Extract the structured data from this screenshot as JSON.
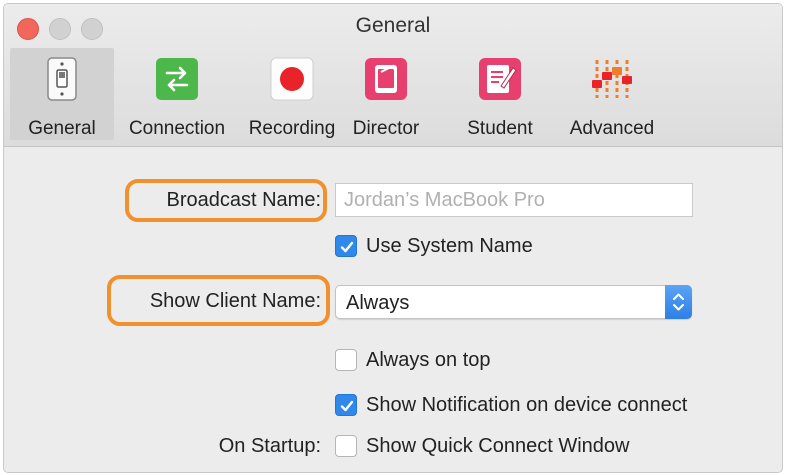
{
  "window": {
    "title": "General"
  },
  "toolbar": {
    "items": [
      {
        "label": "General",
        "icon": "toggle-switch-icon",
        "active": true
      },
      {
        "label": "Connection",
        "icon": "swap-arrows-icon",
        "color": "#4cb84c"
      },
      {
        "label": "Recording",
        "icon": "record-dot-icon",
        "color": "#e8232a"
      },
      {
        "label": "Director",
        "icon": "director-device-icon",
        "color": "#e8406e"
      },
      {
        "label": "Student",
        "icon": "student-notepad-icon",
        "color": "#e8406e"
      },
      {
        "label": "Advanced",
        "icon": "sliders-icon",
        "color": "#f07d2a"
      }
    ]
  },
  "form": {
    "broadcast_name_label": "Broadcast Name:",
    "broadcast_name_placeholder": "Jordan’s MacBook Pro",
    "use_system_name_label": "Use System Name",
    "use_system_name_checked": true,
    "show_client_name_label": "Show Client Name:",
    "show_client_name_value": "Always",
    "always_on_top_label": "Always on top",
    "always_on_top_checked": false,
    "show_notification_label": "Show Notification on device connect",
    "show_notification_checked": true,
    "on_startup_label": "On Startup:",
    "quick_connect_label": "Show Quick Connect Window",
    "quick_connect_checked": false
  },
  "colors": {
    "highlight": "#f0902f",
    "checkbox_on": "#2f88ea"
  }
}
